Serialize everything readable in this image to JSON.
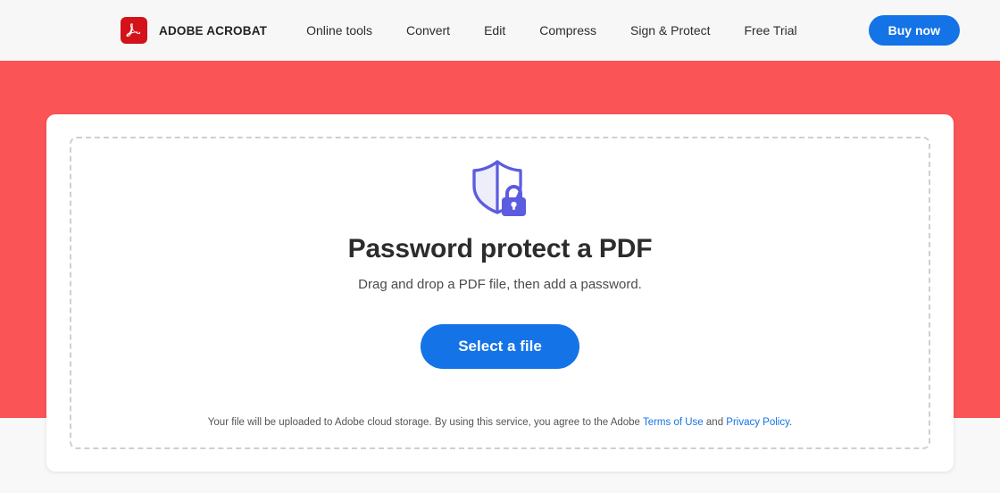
{
  "header": {
    "brand_name": "ADOBE ACROBAT",
    "logo_icon": "acrobat-logo-icon",
    "nav_items": [
      {
        "label": "Online tools"
      },
      {
        "label": "Convert"
      },
      {
        "label": "Edit"
      },
      {
        "label": "Compress"
      },
      {
        "label": "Sign & Protect"
      },
      {
        "label": "Free Trial"
      }
    ],
    "cta_label": "Buy now"
  },
  "main": {
    "icon": "shield-lock-icon",
    "headline": "Password protect a PDF",
    "subhead": "Drag and drop a PDF file, then add a password.",
    "select_file_label": "Select a file",
    "legal": {
      "text_before": "Your file will be uploaded to Adobe cloud storage.  By using this service, you agree to the Adobe ",
      "terms_link": "Terms of Use",
      "conjunction": " and ",
      "privacy_link": "Privacy Policy",
      "text_after": "."
    }
  },
  "colors": {
    "hero_background": "#fb5457",
    "header_background": "#f7f7f7",
    "page_background": "#f8f8f8",
    "accent_blue": "#1473e6",
    "brand_red": "#d3121a",
    "shield_purple": "#5c5ce0",
    "shield_fill": "#eeeefb",
    "dashed_border": "#cfcfcf",
    "link_blue": "#1473e6"
  }
}
